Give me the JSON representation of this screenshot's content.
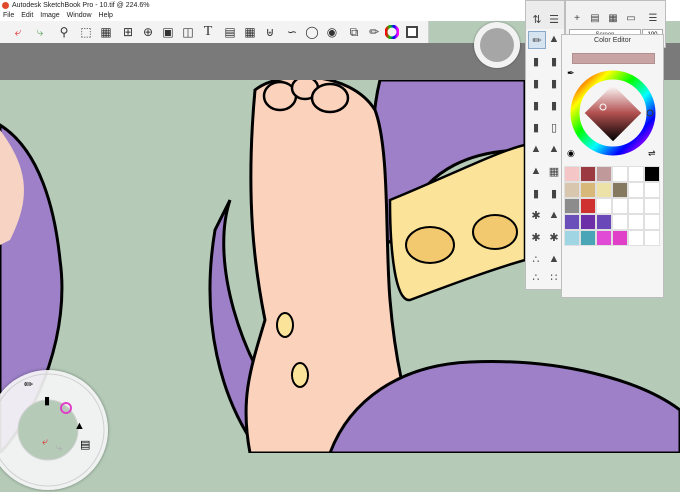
{
  "window": {
    "title": "Autodesk SketchBook Pro - 10.tif @ 224.6%"
  },
  "menu": [
    "File",
    "Edit",
    "Image",
    "Window",
    "Help"
  ],
  "toolbar": {
    "tools": [
      "undo-icon",
      "redo-icon",
      "zoom-icon",
      "select-icon",
      "crop-transform-icon",
      "crop-icon",
      "add-image-icon",
      "layer-transform-icon",
      "distort-icon",
      "text-icon",
      "symmetry-icon",
      "ruler-icon",
      "mirror-icon",
      "curve-icon",
      "ellipse-icon",
      "shape-icon",
      "copy-icon",
      "brush-palette-icon",
      "color-wheel-icon",
      "color-swatch-icon"
    ]
  },
  "color_editor": {
    "title": "Color Editor",
    "current_color": "#c9a4a4",
    "swatches": [
      "#f4c6c6",
      "#9c3a42",
      "#c09a9a",
      "#ffffff",
      "#ffffff",
      "#000000",
      "#d8c6ae",
      "#d8b878",
      "#ece2a8",
      "#857a60",
      "#ffffff",
      "#ffffff",
      "#8c8c8c",
      "#cf3030",
      "#ffffff",
      "#ffffff",
      "#ffffff",
      "#ffffff",
      "#6a4fbb",
      "#6c2fa8",
      "#6a48b8",
      "#ffffff",
      "#ffffff",
      "#ffffff",
      "#a0d6e4",
      "#4aa6b6",
      "#e04ad4",
      "#e040c8",
      "#ffffff",
      "#ffffff"
    ]
  },
  "layers": {
    "blend_mode": "Screen",
    "opacity": "100"
  },
  "brush_library": {
    "brushes": [
      "pencil-brush-icon",
      "airbrush-icon",
      "marker-icon",
      "paint-brush-icon",
      "chisel-brush-icon",
      "ink-pen-icon",
      "felt-pen-icon",
      "water-brush-icon",
      "smudge-icon",
      "eraser-icon",
      "blender-icon",
      "flat-brush-icon",
      "splatter-icon",
      "texture-brush-icon",
      "spray-icon",
      "stamp-icon",
      "droplet-icon",
      "fill-icon",
      "spatter-icon",
      "dust-icon"
    ]
  },
  "accent": "#9d80c8"
}
